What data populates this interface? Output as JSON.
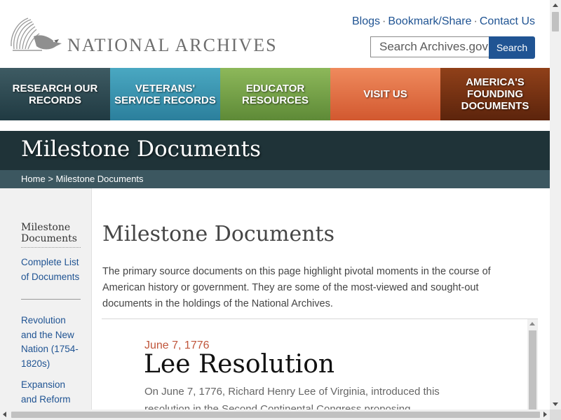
{
  "header": {
    "logo_text": "NATIONAL ARCHIVES",
    "logo_icon": "eagle-logo-icon",
    "util_links": [
      "Blogs",
      "Bookmark/Share",
      "Contact Us"
    ],
    "separator": "·",
    "search": {
      "placeholder": "Search Archives.gov",
      "button_label": "Search"
    }
  },
  "nav": {
    "items": [
      {
        "label": "Research Our Records",
        "color_top": "#3e5b63",
        "color_bottom": "#203a42"
      },
      {
        "label": "Veterans' Service Records",
        "color_top": "#4aa8c2",
        "color_bottom": "#2b7f9c"
      },
      {
        "label": "Educator Resources",
        "color_top": "#8db85a",
        "color_bottom": "#5e8a37"
      },
      {
        "label": "Visit Us",
        "color_top": "#ef8a5d",
        "color_bottom": "#d2582f"
      },
      {
        "label": "America's Founding Documents",
        "color_top": "#904019",
        "color_bottom": "#5c240c"
      }
    ]
  },
  "page": {
    "banner_title": "Milestone Documents",
    "breadcrumb": {
      "home": "Home",
      "separator": ">",
      "current": "Milestone Documents"
    }
  },
  "sidebar": {
    "heading": "Milestone Documents",
    "links": [
      "Complete List of Documents",
      "Revolution and the New Nation (1754-1820s)",
      "Expansion and Reform"
    ]
  },
  "main": {
    "heading": "Milestone Documents",
    "intro": "The primary source documents on this page highlight pivotal moments in the course of American history or government. They are some of the most-viewed and sought-out documents in the holdings of the National Archives.",
    "featured": {
      "date": "June 7, 1776",
      "title": "Lee Resolution",
      "description": "On June 7, 1776, Richard Henry Lee of Virginia, introduced this resolution in the Second Continental Congress proposing"
    }
  },
  "colors": {
    "accent": "#205493",
    "title_band": "#1f3338",
    "crumb_band": "#3c5760",
    "date": "#c0563b"
  }
}
